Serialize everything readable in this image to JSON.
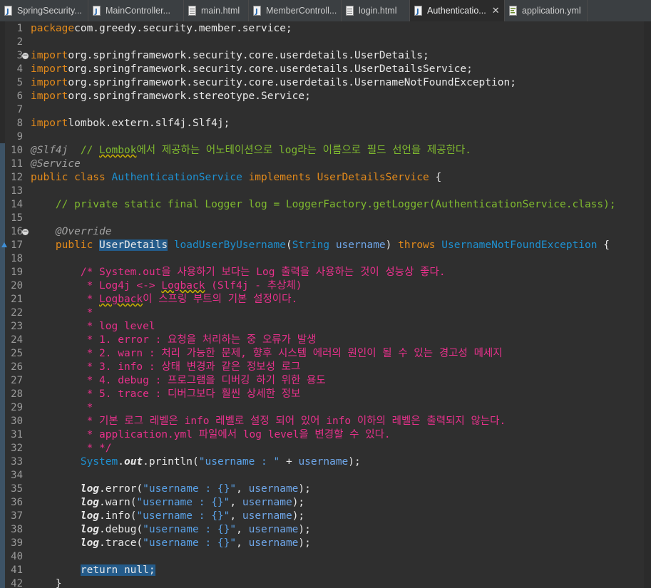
{
  "tabs": [
    {
      "label": "SpringSecurity...",
      "icon": "java-file-icon",
      "active": false,
      "width": 124
    },
    {
      "label": "MainController...",
      "icon": "java-file-icon",
      "active": false,
      "width": 134
    },
    {
      "label": "main.html",
      "icon": "html-file-icon",
      "active": false,
      "width": 91
    },
    {
      "label": "MemberControll...",
      "icon": "java-file-icon",
      "active": false,
      "width": 130
    },
    {
      "label": "login.html",
      "icon": "html-file-icon",
      "active": false,
      "width": 96
    },
    {
      "label": "Authenticatio...",
      "icon": "java-file-icon",
      "active": true,
      "width": 133
    },
    {
      "label": "application.yml",
      "icon": "yml-file-icon",
      "active": false,
      "width": 116
    }
  ],
  "colors": {
    "keyword": "#e38a1b",
    "comment": "#7fba2f",
    "block_comment": "#e8318c",
    "type": "#1e90d0",
    "selection": "#245b8a"
  },
  "lines": [
    {
      "n": "1",
      "t": [
        [
          "kw",
          "package"
        ],
        [
          "",
          "com.greedy.security.member.service;"
        ]
      ]
    },
    {
      "n": "2",
      "t": []
    },
    {
      "n": "3",
      "fold": true,
      "t": [
        [
          "kw",
          "import"
        ],
        [
          "",
          "org.springframework.security.core.userdetails.UserDetails;"
        ]
      ]
    },
    {
      "n": "4",
      "t": [
        [
          "kw",
          "import"
        ],
        [
          "",
          "org.springframework.security.core.userdetails.UserDetailsService;"
        ]
      ]
    },
    {
      "n": "5",
      "t": [
        [
          "kw",
          "import"
        ],
        [
          "",
          "org.springframework.security.core.userdetails.UsernameNotFoundException;"
        ]
      ]
    },
    {
      "n": "6",
      "t": [
        [
          "kw",
          "import"
        ],
        [
          "",
          "org.springframework.stereotype.Service;"
        ]
      ]
    },
    {
      "n": "7",
      "t": []
    },
    {
      "n": "8",
      "t": [
        [
          "kw",
          "import"
        ],
        [
          "",
          "lombok.extern.slf4j.Slf4j;"
        ]
      ]
    },
    {
      "n": "9",
      "t": []
    },
    {
      "n": "10",
      "t": [
        [
          "ann",
          "@Slf4j"
        ],
        [
          "",
          " "
        ],
        [
          "cm",
          " // "
        ],
        [
          "cm squig",
          "Lombok"
        ],
        [
          "cm",
          "에서 제공하는 어노테이션으로 log라는 이름으로 필드 선언을 제공한다."
        ]
      ]
    },
    {
      "n": "11",
      "t": [
        [
          "ann",
          "@Service"
        ]
      ]
    },
    {
      "n": "12",
      "t": [
        [
          "kw",
          "public"
        ],
        [
          "kw",
          " class"
        ],
        [
          "",
          " "
        ],
        [
          "ty",
          "AuthenticationService"
        ],
        [
          "kw",
          " implements"
        ],
        [
          "",
          " "
        ],
        [
          "kw",
          "UserDetailsService"
        ],
        [
          "",
          " {"
        ]
      ]
    },
    {
      "n": "13",
      "t": []
    },
    {
      "n": "14",
      "t": [
        [
          "cm",
          "    // private static final Logger log = LoggerFactory.getLogger(AuthenticationService.class);"
        ]
      ]
    },
    {
      "n": "15",
      "t": []
    },
    {
      "n": "16",
      "fold": true,
      "t": [
        [
          "",
          "    "
        ],
        [
          "ann",
          "@Override"
        ]
      ]
    },
    {
      "n": "17",
      "mark": true,
      "t": [
        [
          "",
          "    "
        ],
        [
          "kw",
          "public"
        ],
        [
          "",
          " "
        ],
        [
          "ty sel",
          "UserDetails"
        ],
        [
          "",
          " "
        ],
        [
          "ty",
          "loadUserByUsername"
        ],
        [
          "",
          "("
        ],
        [
          "ty",
          "String"
        ],
        [
          "",
          " "
        ],
        [
          "var",
          "username"
        ],
        [
          "",
          ") "
        ],
        [
          "kw",
          "throws"
        ],
        [
          "",
          " "
        ],
        [
          "ty",
          "UsernameNotFoundException"
        ],
        [
          "",
          " {"
        ]
      ]
    },
    {
      "n": "18",
      "t": []
    },
    {
      "n": "19",
      "t": [
        [
          "bc",
          "        /* System.out을 사용하기 보다는 Log 출력을 사용하는 것이 성능상 좋다."
        ]
      ]
    },
    {
      "n": "20",
      "t": [
        [
          "bc",
          "         * Log4j <-> "
        ],
        [
          "bc squig",
          "Logback"
        ],
        [
          "bc",
          " (Slf4j - 추상체)"
        ]
      ]
    },
    {
      "n": "21",
      "t": [
        [
          "bc",
          "         * "
        ],
        [
          "bc squig",
          "Logback"
        ],
        [
          "bc",
          "이 스프링 부트의 기본 설정이다."
        ]
      ]
    },
    {
      "n": "22",
      "t": [
        [
          "bc",
          "         *"
        ]
      ]
    },
    {
      "n": "23",
      "t": [
        [
          "bc",
          "         * log level"
        ]
      ]
    },
    {
      "n": "24",
      "t": [
        [
          "bc",
          "         * 1. error : 요청을 처리하는 중 오류가 발생"
        ]
      ]
    },
    {
      "n": "25",
      "t": [
        [
          "bc",
          "         * 2. warn : 처리 가능한 문제, 향후 시스템 에러의 원인이 될 수 있는 경고성 메세지"
        ]
      ]
    },
    {
      "n": "26",
      "t": [
        [
          "bc",
          "         * 3. info : 상태 변경과 같은 정보성 로그"
        ]
      ]
    },
    {
      "n": "27",
      "t": [
        [
          "bc",
          "         * 4. debug : 프로그램을 디버깅 하기 위한 용도"
        ]
      ]
    },
    {
      "n": "28",
      "t": [
        [
          "bc",
          "         * 5. trace : 디버그보다 훨씬 상세한 정보"
        ]
      ]
    },
    {
      "n": "29",
      "t": [
        [
          "bc",
          "         *"
        ]
      ]
    },
    {
      "n": "30",
      "t": [
        [
          "bc",
          "         * 기본 로그 레벨은 info 레벨로 설정 되어 있어 info 이하의 레벨은 출력되지 않는다."
        ]
      ]
    },
    {
      "n": "31",
      "t": [
        [
          "bc",
          "         * application.yml 파일에서 log level을 변경할 수 있다."
        ]
      ]
    },
    {
      "n": "32",
      "t": [
        [
          "bc",
          "         * */"
        ]
      ]
    },
    {
      "n": "33",
      "t": [
        [
          "",
          "        "
        ],
        [
          "ty",
          "System"
        ],
        [
          "",
          "."
        ],
        [
          "fld",
          "out"
        ],
        [
          "",
          ".println("
        ],
        [
          "str",
          "\"username : \""
        ],
        [
          "",
          " + "
        ],
        [
          "var",
          "username"
        ],
        [
          "",
          ");"
        ]
      ]
    },
    {
      "n": "34",
      "t": []
    },
    {
      "n": "35",
      "t": [
        [
          "",
          "        "
        ],
        [
          "fld",
          "log"
        ],
        [
          "",
          ".error("
        ],
        [
          "str",
          "\"username : {}\""
        ],
        [
          "",
          ", "
        ],
        [
          "var",
          "username"
        ],
        [
          "",
          ");"
        ]
      ]
    },
    {
      "n": "36",
      "t": [
        [
          "",
          "        "
        ],
        [
          "fld",
          "log"
        ],
        [
          "",
          ".warn("
        ],
        [
          "str",
          "\"username : {}\""
        ],
        [
          "",
          ", "
        ],
        [
          "var",
          "username"
        ],
        [
          "",
          ");"
        ]
      ]
    },
    {
      "n": "37",
      "t": [
        [
          "",
          "        "
        ],
        [
          "fld",
          "log"
        ],
        [
          "",
          ".info("
        ],
        [
          "str",
          "\"username : {}\""
        ],
        [
          "",
          ", "
        ],
        [
          "var",
          "username"
        ],
        [
          "",
          ");"
        ]
      ]
    },
    {
      "n": "38",
      "t": [
        [
          "",
          "        "
        ],
        [
          "fld",
          "log"
        ],
        [
          "",
          ".debug("
        ],
        [
          "str",
          "\"username : {}\""
        ],
        [
          "",
          ", "
        ],
        [
          "var",
          "username"
        ],
        [
          "",
          ");"
        ]
      ]
    },
    {
      "n": "39",
      "t": [
        [
          "",
          "        "
        ],
        [
          "fld",
          "log"
        ],
        [
          "",
          ".trace("
        ],
        [
          "str",
          "\"username : {}\""
        ],
        [
          "",
          ", "
        ],
        [
          "var",
          "username"
        ],
        [
          "",
          ");"
        ]
      ]
    },
    {
      "n": "40",
      "t": []
    },
    {
      "n": "41",
      "t": [
        [
          "",
          "        "
        ],
        [
          "kw sel",
          "return null;"
        ]
      ]
    },
    {
      "n": "42",
      "t": [
        [
          "",
          "    }"
        ]
      ]
    }
  ]
}
